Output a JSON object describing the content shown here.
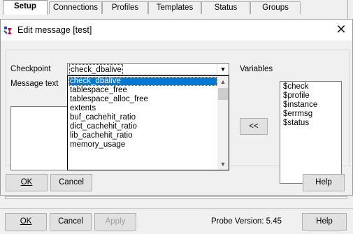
{
  "tabs": [
    "Setup",
    "Connections",
    "Profiles",
    "Templates",
    "Status",
    "Groups"
  ],
  "dialog": {
    "title": "Edit message [test]",
    "checkpoint_label": "Checkpoint",
    "message_label": "Message text",
    "variables_label": "Variables",
    "checkpoint_value": "check_dbalive",
    "checkpoint_options": [
      "check_dbalive",
      "tablespace_free",
      "tablespace_alloc_free",
      "extents",
      "buf_cachehit_ratio",
      "dict_cachehit_ratio",
      "lib_cachehit_ratio",
      "memory_usage"
    ],
    "variables": [
      "$check",
      "$profile",
      "$instance",
      "$errmsg",
      "$status"
    ],
    "insert_label": "<<",
    "ok": "OK",
    "cancel": "Cancel",
    "help": "Help"
  },
  "footer": {
    "ok": "OK",
    "cancel": "Cancel",
    "apply": "Apply",
    "version": "Probe Version: 5.45",
    "help": "Help"
  }
}
